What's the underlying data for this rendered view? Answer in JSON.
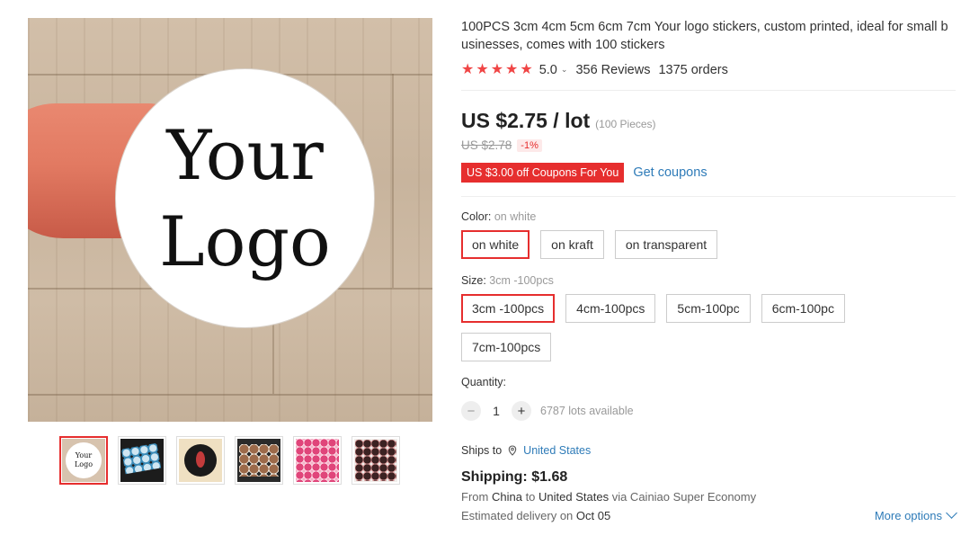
{
  "gallery": {
    "main_image": {
      "line1": "Your",
      "line2": "Logo"
    },
    "thumbnails": [
      {
        "name": "thumb-your-logo",
        "mini1": "Your",
        "mini2": "Logo",
        "active": true
      },
      {
        "name": "thumb-blue-stickers"
      },
      {
        "name": "thumb-black-round-sticker"
      },
      {
        "name": "thumb-brown-stickers"
      },
      {
        "name": "thumb-pink-stickers"
      },
      {
        "name": "thumb-dark-stickers"
      }
    ]
  },
  "product": {
    "title": "100PCS 3cm 4cm 5cm 6cm 7cm Your logo stickers, custom printed, ideal for small businesses, comes with 100 stickers",
    "rating": "5.0",
    "reviews": "356 Reviews",
    "orders": "1375 orders",
    "price": "US $2.75 / lot",
    "pieces": "(100 Pieces)",
    "original_price": "US $2.78",
    "discount": "-1%",
    "coupon": "US $3.00 off Coupons For You",
    "get_coupons": "Get coupons"
  },
  "color": {
    "label": "Color:",
    "selected": "on white",
    "options": [
      "on white",
      "on kraft",
      "on transparent"
    ]
  },
  "size": {
    "label": "Size:",
    "selected": "3cm -100pcs",
    "options": [
      "3cm -100pcs",
      "4cm-100pcs",
      "5cm-100pc",
      "6cm-100pc",
      "7cm-100pcs"
    ]
  },
  "quantity": {
    "label": "Quantity:",
    "value": "1",
    "minus": "−",
    "plus": "+",
    "available": "6787 lots available"
  },
  "shipping": {
    "ships_to_label": "Ships to",
    "country": "United States",
    "cost": "Shipping: $1.68",
    "from_word": "From",
    "origin": "China",
    "to_word": "to",
    "destination": "United States",
    "via": "via Cainiao Super Economy",
    "est_label": "Estimated delivery on",
    "est_date": "Oct 05",
    "more_options": "More options"
  },
  "colors": {
    "accent": "#e62e2e",
    "star": "#f04545",
    "link": "#2e7bb8"
  },
  "icons": [
    "star-icon",
    "chevron-down-icon",
    "location-pin-icon",
    "minus-icon",
    "plus-icon"
  ]
}
